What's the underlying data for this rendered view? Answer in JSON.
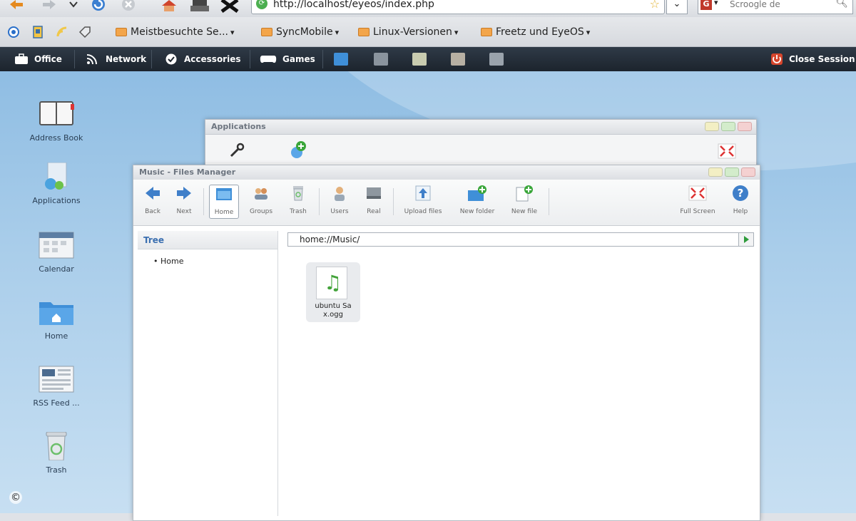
{
  "browser": {
    "url": "http://localhost/eyeos/index.php",
    "search_placeholder": "Scroogle de"
  },
  "bookmarks": [
    {
      "label": "Meistbesuchte Se...",
      "arrow": "▾"
    },
    {
      "label": "SyncMobile",
      "arrow": "▾"
    },
    {
      "label": "Linux-Versionen",
      "arrow": "▾"
    },
    {
      "label": "Freetz und EyeOS",
      "arrow": "▾"
    }
  ],
  "menubar": {
    "items": [
      {
        "label": "Office",
        "icon": "briefcase-icon"
      },
      {
        "label": "Network",
        "icon": "rss-icon"
      },
      {
        "label": "Accessories",
        "icon": "check-icon"
      },
      {
        "label": "Games",
        "icon": "gamepad-icon"
      }
    ],
    "close_session": "Close Session"
  },
  "desktop_icons": [
    {
      "label": "Address Book",
      "icon": "address-book-icon"
    },
    {
      "label": "Applications",
      "icon": "applications-icon"
    },
    {
      "label": "Calendar",
      "icon": "calendar-icon"
    },
    {
      "label": "Home",
      "icon": "home-folder-icon"
    },
    {
      "label": "RSS Feed ...",
      "icon": "rss-feed-icon"
    },
    {
      "label": "Trash",
      "icon": "trash-icon"
    }
  ],
  "applications_window": {
    "title": "Applications"
  },
  "files_window": {
    "title": "Music - Files Manager",
    "toolbar": {
      "back": "Back",
      "next": "Next",
      "home": "Home",
      "groups": "Groups",
      "trash": "Trash",
      "users": "Users",
      "real": "Real",
      "upload": "Upload files",
      "new_folder": "New folder",
      "new_file": "New file",
      "full_screen": "Full Screen",
      "help": "Help"
    },
    "tree": {
      "header": "Tree",
      "home": "Home"
    },
    "path": "home://Music/",
    "files": [
      {
        "name": "ubuntu Sa x.ogg",
        "icon": "music-note-icon"
      }
    ]
  },
  "copyright_symbol": "©",
  "colors": {
    "menubar_bg": "#1c242d",
    "desktop_bg": "#a9cdea",
    "accent_blue": "#3b6fb0",
    "go_green": "#2e9b3a"
  }
}
